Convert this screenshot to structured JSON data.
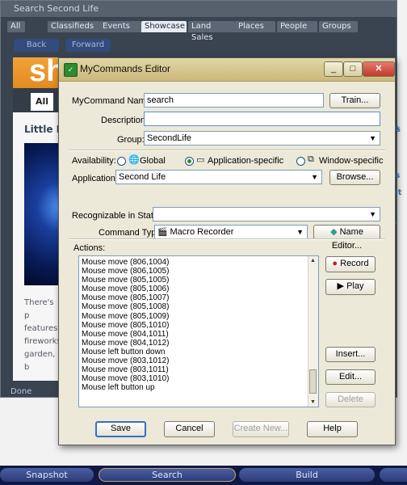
{
  "sl": {
    "title": "Search Second Life",
    "tabs": [
      "All",
      "Classifieds",
      "Events",
      "Showcase",
      "Land Sales",
      "Places",
      "People",
      "Groups"
    ],
    "back": "Back",
    "forward": "Forward",
    "banner": "sh",
    "all_button": "All",
    "heading": "Little K",
    "desc": [
      "There's p",
      "features",
      "fireworks",
      "garden, b"
    ],
    "right_letters": [
      "s",
      "is",
      "et",
      "y"
    ],
    "done": "Done"
  },
  "bottom": {
    "snapshot": "Snapshot",
    "search": "Search",
    "build": "Build"
  },
  "dialog": {
    "title": "MyCommands Editor",
    "caption": {
      "min": "_",
      "max": "□",
      "close": "✕"
    },
    "name_label": "MyCommand Name:",
    "name_value": "search",
    "train": "Train...",
    "description_label": "Description:",
    "description_value": "",
    "group_label": "Group:",
    "group_value": "SecondLife",
    "availability_label": "Availability:",
    "avail": {
      "global": "Global",
      "app": "Application-specific",
      "window": "Window-specific"
    },
    "application_label": "Application:",
    "application_value": "Second Life",
    "browse": "Browse...",
    "states_label": "Recognizable in States:",
    "states_value": "",
    "cmdtype_label": "Command Type:",
    "cmdtype_value": "Macro Recorder",
    "name_editor": "Name Editor...",
    "actions_label": "Actions:",
    "actions": [
      "Mouse move (806,1004)",
      "Mouse move (806,1005)",
      "Mouse move (805,1005)",
      "Mouse move (805,1006)",
      "Mouse move (805,1007)",
      "Mouse move (805,1008)",
      "Mouse move (805,1009)",
      "Mouse move (805,1010)",
      "Mouse move (804,1011)",
      "Mouse move (804,1012)",
      "Mouse left button down",
      "Mouse move (803,1012)",
      "Mouse move (803,1011)",
      "Mouse move (803,1010)",
      "Mouse left button up"
    ],
    "record": "Record",
    "play": "Play",
    "insert": "Insert...",
    "edit": "Edit...",
    "delete": "Delete",
    "save": "Save",
    "cancel": "Cancel",
    "create_new": "Create New...",
    "help": "Help"
  }
}
